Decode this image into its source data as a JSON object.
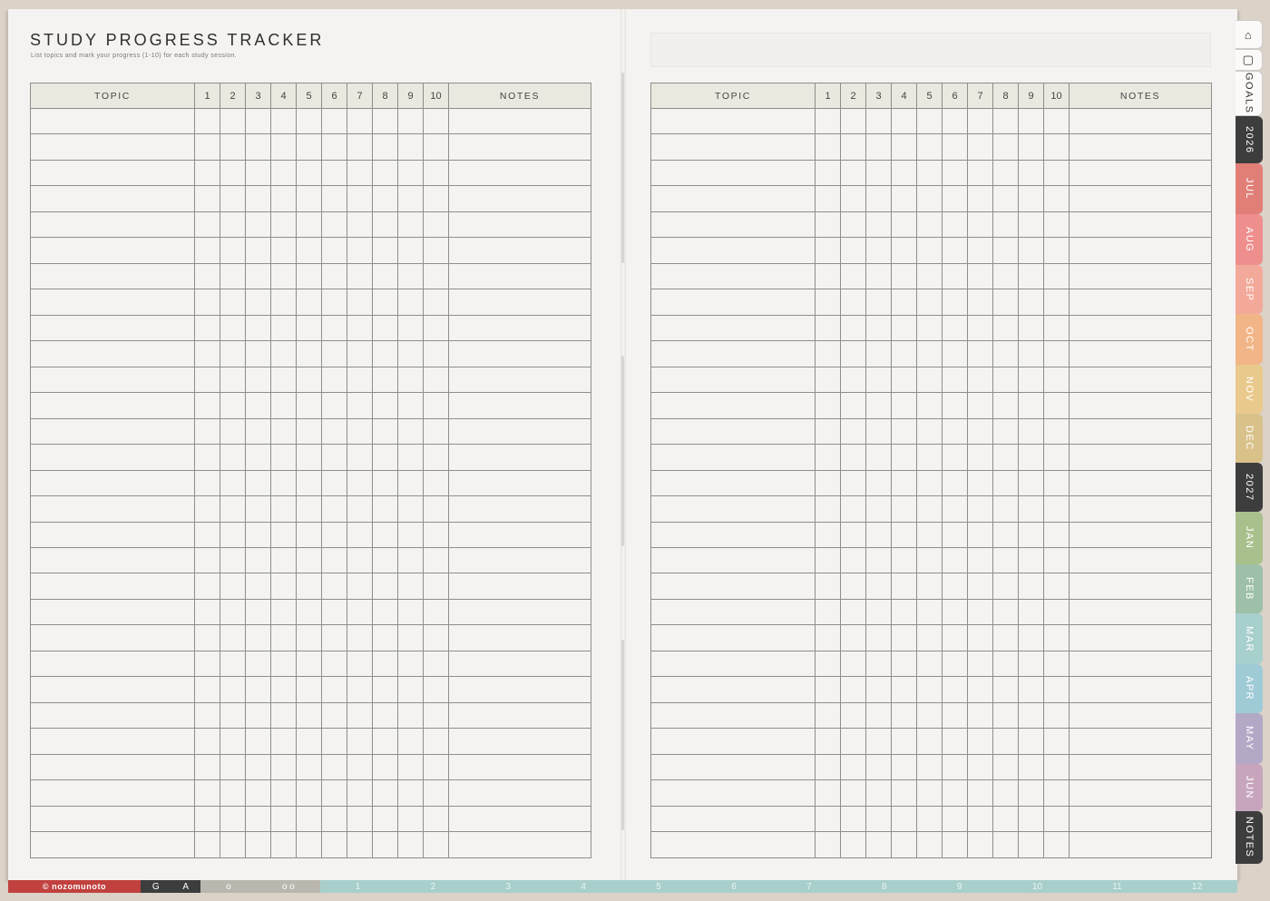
{
  "page": {
    "title": "STUDY PROGRESS TRACKER",
    "subtitle": "List topics and mark your progress (1-10) for each study session."
  },
  "table": {
    "topic_header": "TOPIC",
    "sessions": [
      "1",
      "2",
      "3",
      "4",
      "5",
      "6",
      "7",
      "8",
      "9",
      "10"
    ],
    "notes_header": "NOTES",
    "rows_per_page": 29
  },
  "side_tabs": [
    {
      "label": "",
      "icon": "home-icon",
      "color": "#fbfaf8"
    },
    {
      "label": "",
      "icon": "square-icon",
      "color": "#fbfaf8"
    },
    {
      "label": "GOALS",
      "color": "#fbfaf8"
    },
    {
      "label": "2026",
      "color": "#3d3d3d"
    },
    {
      "label": "JUL",
      "color": "#e07e77"
    },
    {
      "label": "AUG",
      "color": "#ee8f8e"
    },
    {
      "label": "SEP",
      "color": "#f3a99a"
    },
    {
      "label": "OCT",
      "color": "#f2b588"
    },
    {
      "label": "NOV",
      "color": "#e9c98c"
    },
    {
      "label": "DEC",
      "color": "#d9c18a"
    },
    {
      "label": "2027",
      "color": "#3d3d3d"
    },
    {
      "label": "JAN",
      "color": "#a9c08c"
    },
    {
      "label": "FEB",
      "color": "#9ec0a8"
    },
    {
      "label": "MAR",
      "color": "#a7cfcc"
    },
    {
      "label": "APR",
      "color": "#9fcbd6"
    },
    {
      "label": "MAY",
      "color": "#b3a8c6"
    },
    {
      "label": "JUN",
      "color": "#c7a6bd"
    },
    {
      "label": "NOTES",
      "color": "#3d3d3d"
    }
  ],
  "footer": {
    "brand": "© nozomunoto",
    "ga_labels": [
      "G",
      "A"
    ],
    "o_labels": [
      "o",
      "o o"
    ],
    "month_numbers": [
      "1",
      "2",
      "3",
      "4",
      "5",
      "6",
      "7",
      "8",
      "9",
      "10",
      "11",
      "12"
    ]
  }
}
